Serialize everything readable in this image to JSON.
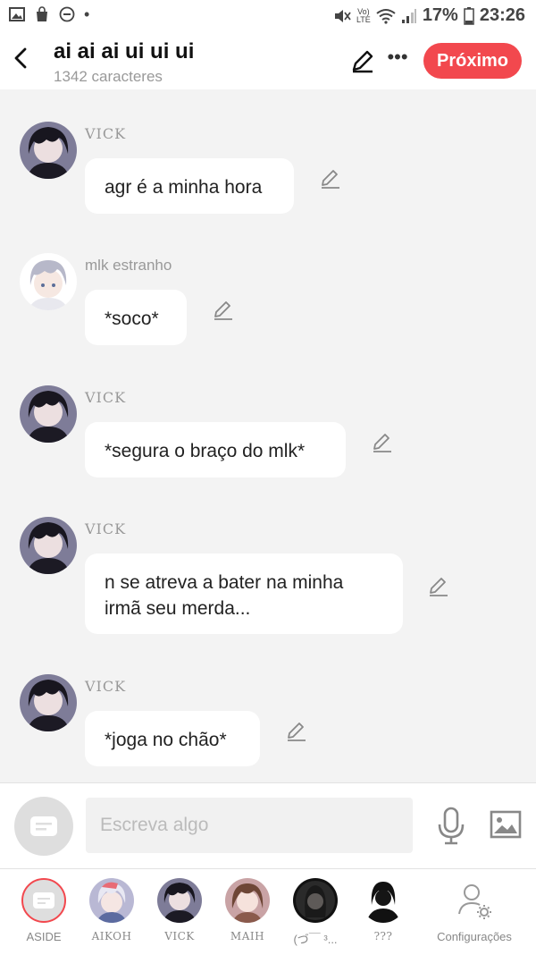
{
  "status_bar": {
    "battery": "17%",
    "time": "23:26"
  },
  "header": {
    "title": "ai ai ai ui ui ui",
    "subtitle": "1342 caracteres",
    "next_label": "Próximo"
  },
  "messages": [
    {
      "name": "VICK",
      "text": "agr é a minha hora"
    },
    {
      "name": "mlk estranho",
      "text": "*soco*"
    },
    {
      "name": "VICK",
      "text": "*segura o braço do mlk*"
    },
    {
      "name": "VICK",
      "text": "n se atreva a bater na minha irmã seu merda..."
    },
    {
      "name": "VICK",
      "text": "*joga no chão*"
    }
  ],
  "composer": {
    "placeholder": "Escreva algo"
  },
  "dock": {
    "items": [
      {
        "label": "ASIDE"
      },
      {
        "label": "AIKOH"
      },
      {
        "label": "VICK"
      },
      {
        "label": "MAIH"
      },
      {
        "label": "(づ￣ ³..."
      },
      {
        "label": "???"
      },
      {
        "label": "Configurações"
      }
    ]
  },
  "colors": {
    "accent": "#f2484e",
    "bubble": "#ffffff",
    "background": "#f3f3f3"
  }
}
